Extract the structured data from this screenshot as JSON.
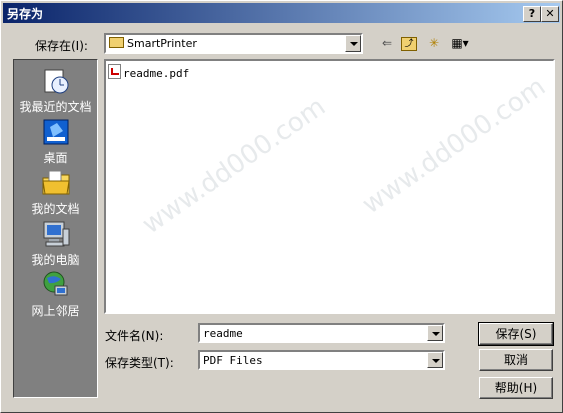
{
  "window": {
    "title": "另存为",
    "help_icon": "?",
    "close_icon": "✕"
  },
  "savein": {
    "label": "保存在(I):",
    "value": "SmartPrinter"
  },
  "toolbar": {
    "back": "⇐",
    "up": "⤴",
    "newfolder": "✳",
    "views": "▦"
  },
  "places": [
    {
      "label": "我最近的文档",
      "icon": "recent-documents-icon"
    },
    {
      "label": "桌面",
      "icon": "desktop-icon"
    },
    {
      "label": "我的文档",
      "icon": "my-documents-icon"
    },
    {
      "label": "我的电脑",
      "icon": "my-computer-icon"
    },
    {
      "label": "网上邻居",
      "icon": "network-places-icon"
    }
  ],
  "files": [
    {
      "name": "readme.pdf",
      "icon": "pdf-file-icon"
    }
  ],
  "filename": {
    "label": "文件名(N):",
    "value": "readme"
  },
  "filetype": {
    "label": "保存类型(T):",
    "value": "PDF Files"
  },
  "buttons": {
    "save": "保存(S)",
    "cancel": "取消",
    "help": "帮助(H)"
  },
  "colors": {
    "title_start": "#0a246a",
    "title_end": "#a6caf0",
    "places_bg": "#808080",
    "face": "#d4d0c8"
  }
}
